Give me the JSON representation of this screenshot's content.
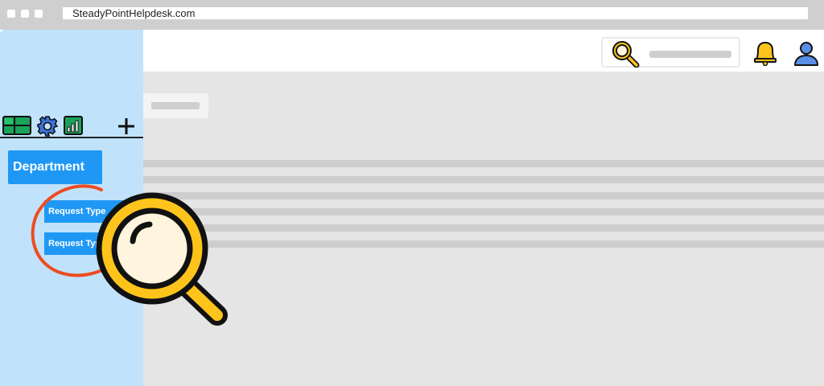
{
  "browser": {
    "url": "SteadyPointHelpdesk.com"
  },
  "sidebar": {
    "toolbar_icons": [
      "dashboard-icon",
      "gear-icon",
      "bar-chart-icon",
      "plus-icon"
    ],
    "department_label": "Department",
    "request_types": [
      {
        "label": "Request Type"
      },
      {
        "label": "Request Type"
      }
    ]
  },
  "header": {
    "icons": [
      "search-icon",
      "bell-icon",
      "user-icon"
    ]
  },
  "overlay": {
    "icon": "magnifier-icon",
    "highlight": "red-circle-highlight"
  },
  "colors": {
    "sidebar_bg": "#c0e3fb",
    "accent_blue": "#1f98f5",
    "magnifier_yellow": "#ffc41c",
    "highlight_red": "#ee4c23",
    "content_bg": "#e5e5e5"
  }
}
